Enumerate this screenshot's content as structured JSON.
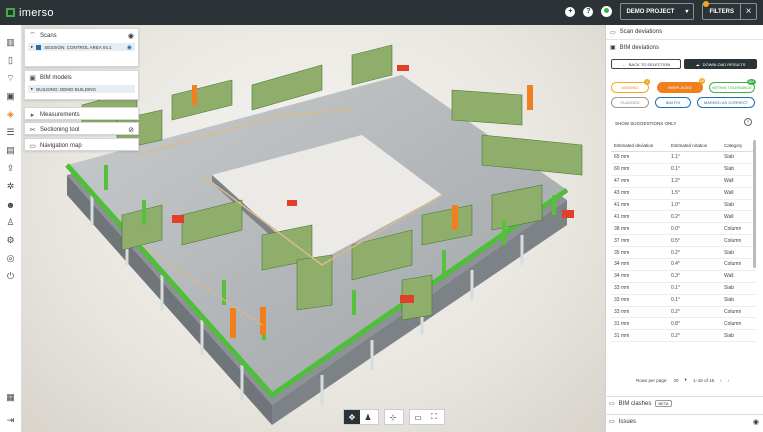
{
  "app": {
    "name": "imerso"
  },
  "topbar": {
    "project": "DEMO PROJECT",
    "filters_label": "FILTERS"
  },
  "left_panels": {
    "scans": {
      "title": "Scans",
      "session": "SESSION: CONTROL AREA 04.1"
    },
    "bim_models": {
      "title": "BIM models",
      "building": "BUILDING: DEMO BUILDING"
    },
    "measurements": {
      "title": "Measurements"
    },
    "sectioning": {
      "title": "Sectioning tool"
    },
    "navigation": {
      "title": "Navigation map"
    }
  },
  "right_panel": {
    "scan_deviations": "Scan deviations",
    "bim_deviations": "BIM deviations",
    "back_btn": "BACK TO SELECTION",
    "download_btn": "DOWNLOAD RESULTS",
    "tabs": [
      {
        "label": "MISSING",
        "badge": "1"
      },
      {
        "label": "MISPLACED",
        "badge": "16"
      },
      {
        "label": "WITHIN TOLERANCE",
        "badge": "99+"
      }
    ],
    "actions": [
      "FLAGGED",
      "BIM FIX",
      "MARKED AS CORRECT"
    ],
    "show_suggestions": "SHOW SUGGESTIONS ONLY",
    "columns": [
      "Estimated deviation",
      "Estimated rotation",
      "Category"
    ],
    "rows": [
      [
        "65 mm",
        "1.1°",
        "Slab"
      ],
      [
        "60 mm",
        "0.1°",
        "Slab"
      ],
      [
        "47 mm",
        "1.2°",
        "Wall"
      ],
      [
        "43 mm",
        "1.5°",
        "Wall"
      ],
      [
        "41 mm",
        "1.0°",
        "Slab"
      ],
      [
        "41 mm",
        "0.2°",
        "Wall"
      ],
      [
        "38 mm",
        "0.0°",
        "Column"
      ],
      [
        "37 mm",
        "0.5°",
        "Column"
      ],
      [
        "35 mm",
        "0.2°",
        "Slab"
      ],
      [
        "34 mm",
        "0.4°",
        "Column"
      ],
      [
        "34 mm",
        "0.3°",
        "Wall"
      ],
      [
        "33 mm",
        "0.1°",
        "Slab"
      ],
      [
        "33 mm",
        "0.1°",
        "Slab"
      ],
      [
        "33 mm",
        "0.2°",
        "Column"
      ],
      [
        "31 mm",
        "0.8°",
        "Column"
      ],
      [
        "31 mm",
        "0.2°",
        "Slab"
      ]
    ],
    "pagination": {
      "rows_per_page_label": "Rows per page:",
      "rows_per_page": "20",
      "range": "1–16 of 16"
    },
    "bim_clashes": "BIM clashes",
    "beta": "BETA",
    "issues": "Issues"
  },
  "colors": {
    "accent_green": "#3fae49",
    "topbar": "#2b3336",
    "orange": "#f5a623",
    "orange_dark": "#f07f1e"
  }
}
